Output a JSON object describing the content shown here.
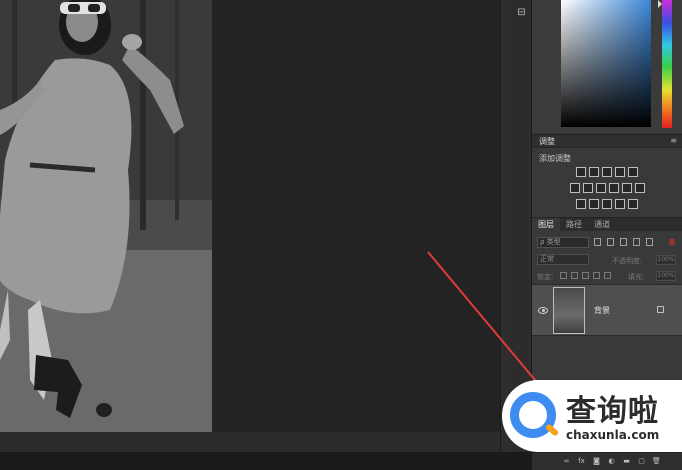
{
  "canvas": {
    "image_alt": "grayscale photo of woman in dress"
  },
  "colors": {
    "accent_arrow": "#e03a3a",
    "watermark_blue": "#3f8cf0",
    "watermark_orange": "#f6a11a"
  },
  "panels": {
    "adjustments": {
      "title": "调整",
      "subtitle": "添加调整"
    },
    "layers": {
      "tabs": [
        "图层",
        "路径",
        "通道"
      ],
      "filter_placeholder": "ρ 类型",
      "blend_mode": "正常",
      "opacity_label": "不透明度:",
      "opacity_value": "100%",
      "lock_label": "锁定:",
      "fill_label": "填充:",
      "fill_value": "100%",
      "layer_name": "背景"
    }
  },
  "bottom_bar": {
    "icons": [
      "link-icon",
      "fx-icon",
      "mask-icon",
      "adjustment-icon",
      "group-icon",
      "new-layer-icon",
      "delete-icon"
    ],
    "fx_label": "fx"
  },
  "watermark": {
    "text": "查询啦",
    "url": "chaxunla.com"
  }
}
